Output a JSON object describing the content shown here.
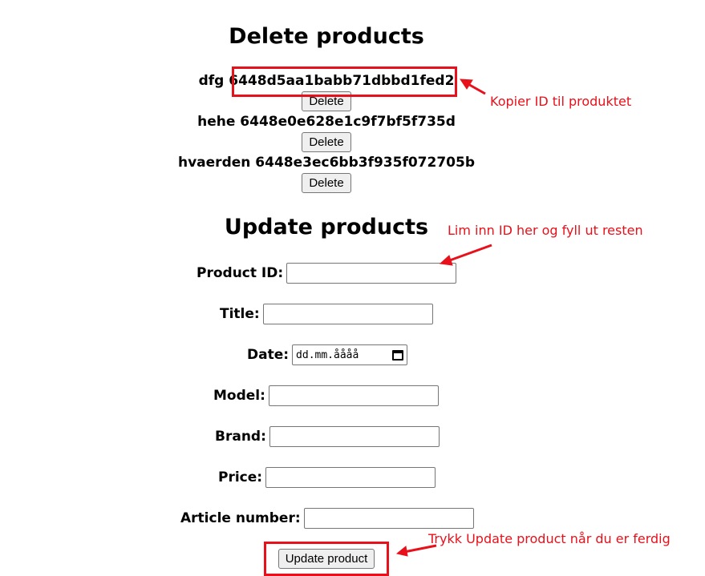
{
  "delete_section": {
    "title": "Delete products",
    "products": [
      {
        "name": "dfg",
        "id": "6448d5aa1babb71dbbd1fed2"
      },
      {
        "name": "hehe",
        "id": "6448e0e628e1c9f7bf5f735d"
      },
      {
        "name": "hvaerden",
        "id": "6448e3ec6bb3f935f072705b"
      }
    ],
    "delete_label": "Delete"
  },
  "update_section": {
    "title": "Update products",
    "fields": {
      "product_id": "Product ID:",
      "title": "Title:",
      "date": "Date:",
      "model": "Model:",
      "brand": "Brand:",
      "price": "Price:",
      "article_number": "Article number:"
    },
    "date_placeholder": "dd.mm.åååå",
    "submit_label": "Update product"
  },
  "annotations": {
    "copy_id": "Kopier ID til produktet",
    "paste_id": "Lim inn ID her og fyll ut resten",
    "press_update": "Trykk Update product når du er ferdig",
    "color": "#e8101a"
  }
}
